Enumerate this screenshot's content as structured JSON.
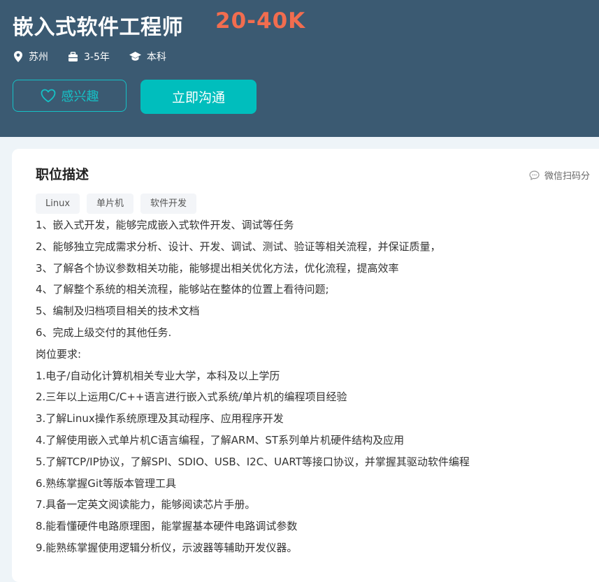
{
  "header": {
    "title": "嵌入式软件工程师",
    "salary": "20-40K",
    "location": "苏州",
    "experience": "3-5年",
    "degree": "本科",
    "interest_label": "感兴趣",
    "chat_label": "立即沟通"
  },
  "description": {
    "heading": "职位描述",
    "share_label": "微信扫码分",
    "tags": [
      "Linux",
      "单片机",
      "软件开发"
    ],
    "lines": [
      "1、嵌入式开发，能够完成嵌入式软件开发、调试等任务",
      "2、能够独立完成需求分析、设计、开发、调试、测试、验证等相关流程，并保证质量，",
      "3、了解各个协议参数相关功能，能够提出相关优化方法，优化流程，提高效率",
      "4、了解整个系统的相关流程，能够站在整体的位置上看待问题;",
      "5、编制及归档项目相关的技术文档",
      "6、完成上级交付的其他任务.",
      "岗位要求:",
      "1.电子/自动化计算机相关专业大学，本科及以上学历",
      "2.三年以上运用C/C++语言进行嵌入式系统/单片机的编程项目经验",
      "3.了解Linux操作系统原理及其动程序、应用程序开发",
      "4.了解使用嵌入式单片机C语言编程，了解ARM、ST系列单片机硬件结构及应用",
      "5.了解TCP/IP协议，了解SPI、SDIO、USB、I2C、UART等接口协议，并掌握其驱动软件编程",
      "6.熟练掌握Git等版本管理工具",
      "7.具备一定英文阅读能力，能够阅读芯片手册。",
      "8.能看懂硬件电路原理图，能掌握基本硬件电路调试参数",
      "9.能熟练掌握使用逻辑分析仪，示波器等辅助开发仪器。"
    ]
  },
  "colors": {
    "banner": "#3b5a72",
    "salary": "#f26d4f",
    "accent": "#00bebd"
  },
  "icons": {
    "location": "location-pin-icon",
    "experience": "briefcase-icon",
    "degree": "graduation-cap-icon",
    "interest": "heart-icon",
    "share": "chat-bubble-icon"
  }
}
